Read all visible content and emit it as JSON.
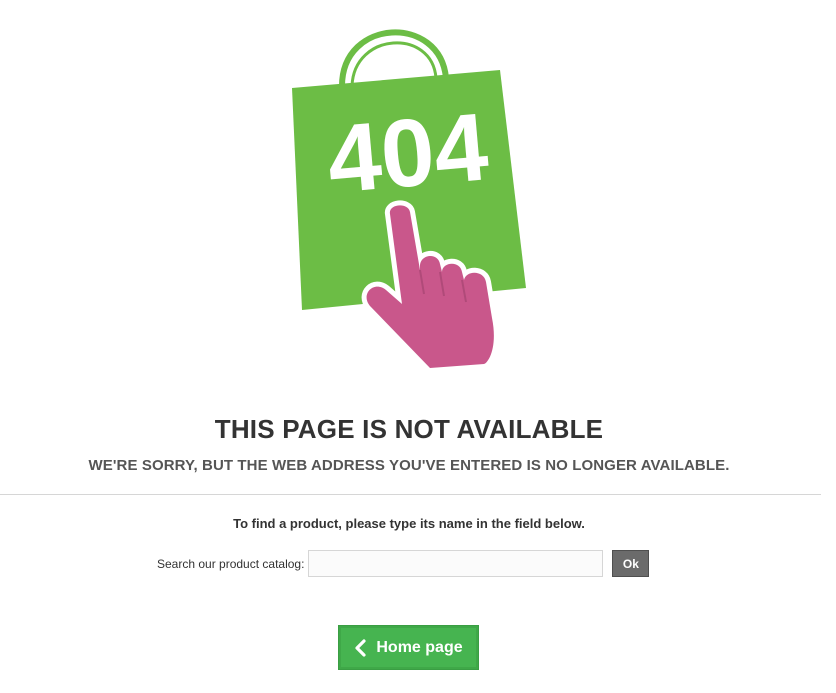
{
  "illustration": {
    "code_text": "404",
    "bag_color": "#6cbd45",
    "hand_color": "#c9578b",
    "icon": "shopping-bag-404-icon"
  },
  "main": {
    "title": "THIS PAGE IS NOT AVAILABLE",
    "subtitle": "WE'RE SORRY, BUT THE WEB ADDRESS YOU'VE ENTERED IS NO LONGER AVAILABLE."
  },
  "search": {
    "hint": "To find a product, please type its name in the field below.",
    "label": "Search our product catalog:",
    "value": "",
    "placeholder": "",
    "submit_label": "Ok"
  },
  "home_button": {
    "label": "Home page",
    "icon": "chevron-left-icon",
    "color": "#46b450"
  }
}
